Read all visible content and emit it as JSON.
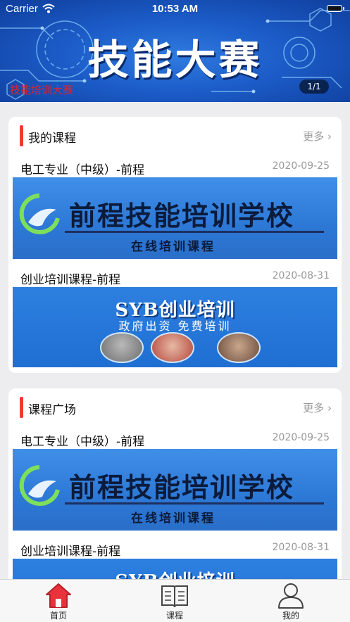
{
  "status_bar": {
    "carrier": "Carrier",
    "time": "10:53 AM"
  },
  "banner": {
    "title": "技能大赛",
    "caption": "技能培训大赛",
    "pager": "1/1"
  },
  "my_courses": {
    "title": "我的课程",
    "more": "更多 ›",
    "items": [
      {
        "title": "电工专业（中级）-前程",
        "date": "2020-09-25",
        "thumb_title": "前程技能培训学校",
        "thumb_sub": "在线培训课程"
      },
      {
        "title": "创业培训课程-前程",
        "date": "2020-08-31",
        "thumb_title": "SYB创业培训",
        "thumb_sub": "政府出资 免费培训"
      }
    ]
  },
  "course_square": {
    "title": "课程广场",
    "more": "更多 ›",
    "items": [
      {
        "title": "电工专业（中级）-前程",
        "date": "2020-09-25",
        "thumb_title": "前程技能培训学校",
        "thumb_sub": "在线培训课程"
      },
      {
        "title": "创业培训课程-前程",
        "date": "2020-08-31",
        "thumb_title": "SYB创业培训"
      }
    ]
  },
  "tabbar": {
    "items": [
      {
        "label": "首页",
        "icon": "home-icon",
        "active": true
      },
      {
        "label": "课程",
        "icon": "book-icon",
        "active": false
      },
      {
        "label": "我的",
        "icon": "user-icon",
        "active": false
      }
    ],
    "active_color": "#e8323c"
  },
  "colors": {
    "accent_bar": "#f03a2e",
    "banner_blue": "#1c5cc8",
    "caption_red": "#e0242e"
  }
}
